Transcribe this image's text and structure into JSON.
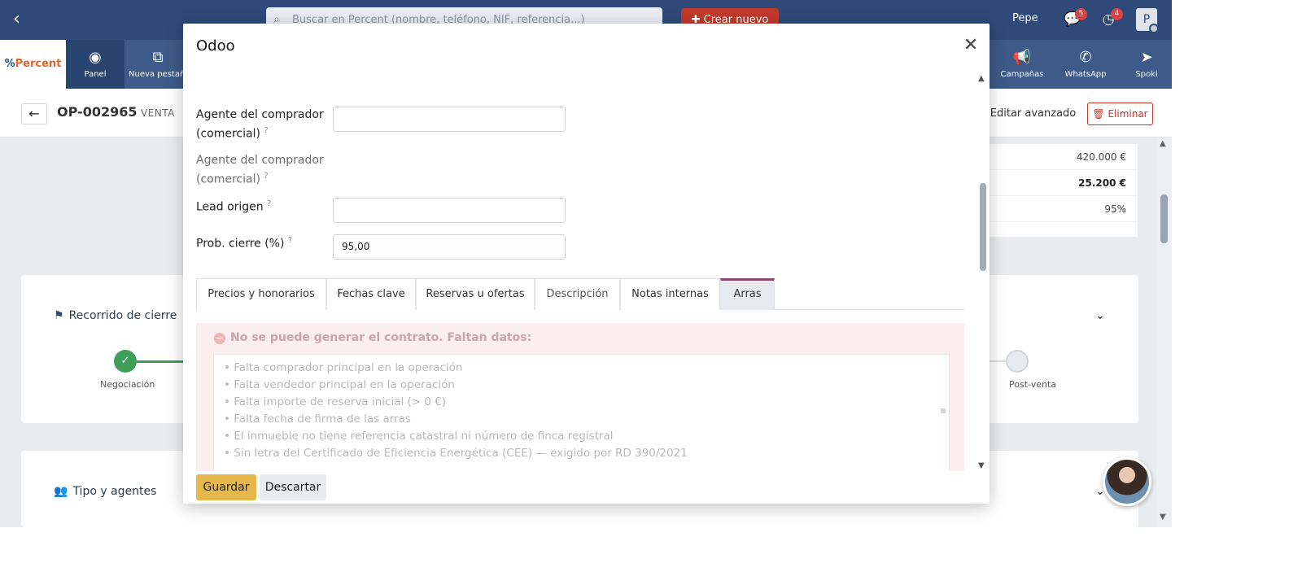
{
  "topbar": {
    "search_placeholder": "Buscar en Percent (nombre, teléfono, NIF, referencia...)",
    "create_label": "Crear nuevo",
    "user_name": "Pepe",
    "chat_badge": "5",
    "activity_badge": "4",
    "avatar_initial": "P"
  },
  "appbar": {
    "brand": "Percent",
    "items": [
      {
        "label": "Panel",
        "icon": "dashboard-icon"
      },
      {
        "label": "Nueva pestaña",
        "icon": "external-link-icon"
      },
      {
        "label": "Campañas",
        "icon": "megaphone-icon"
      },
      {
        "label": "WhatsApp",
        "icon": "whatsapp-icon"
      },
      {
        "label": "Spoki",
        "icon": "send-icon"
      }
    ]
  },
  "record": {
    "ref": "OP-002965",
    "type": "VENTA",
    "edit_label": "Editar avanzado",
    "delete_label": "Eliminar",
    "side_values": [
      "420.000 €",
      "25.200 €",
      "95%"
    ]
  },
  "cards": {
    "closing_title": "Recorrido de cierre",
    "stage_first": "Negociación",
    "stage_last": "Post-venta",
    "agents_title": "Tipo y agentes"
  },
  "modal": {
    "title": "Odoo",
    "fields": [
      {
        "label": "Agente del comprador (comercial)",
        "value": ""
      },
      {
        "label": "Agente del comprador (comercial)",
        "value": ""
      },
      {
        "label": "Lead origen",
        "value": ""
      },
      {
        "label": "Prob. cierre (%)",
        "value": "95,00"
      }
    ],
    "tabs": [
      "Precios y honorarios",
      "Fechas clave",
      "Reservas u ofertas",
      "Descripción",
      "Notas internas",
      "Arras"
    ],
    "alert_title": "No se puede generar el contrato. Faltan datos:",
    "alert_items": [
      "• Falta comprador principal en la operación",
      "• Falta vendedor principal en la operación",
      "• Falta importe de reserva inicial (> 0 €)",
      "• Falta fecha de firma de las arras",
      "• El inmueble no tiene referencia catastral ni número de finca registral",
      "• Sin letra del Certificado de Eficiencia Energética (CEE) — exigido por RD 390/2021"
    ],
    "save_label": "Guardar",
    "discard_label": "Descartar"
  }
}
